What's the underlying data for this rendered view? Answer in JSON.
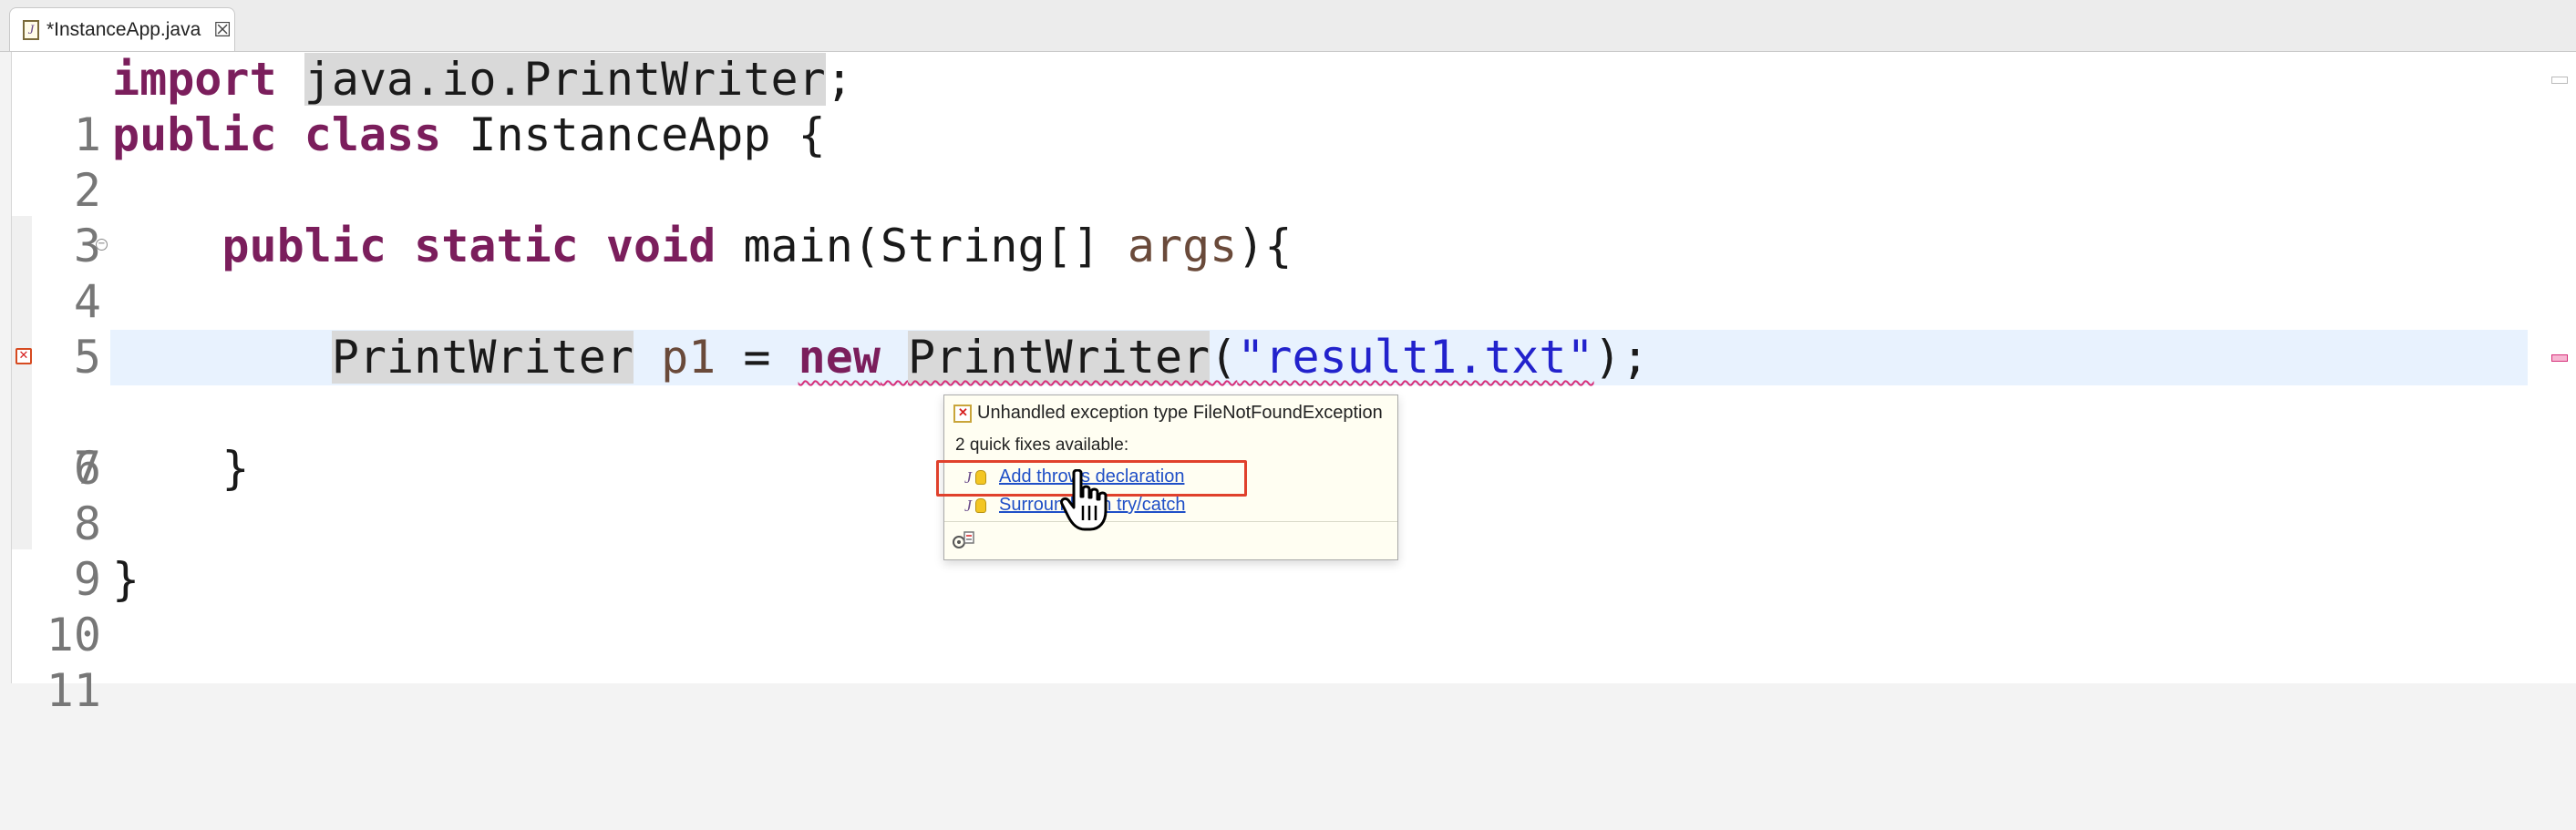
{
  "tab": {
    "label": "*InstanceApp.java",
    "close": "☒",
    "icon": "J"
  },
  "editor": {
    "lines": [
      {
        "num": "1",
        "tokens": [
          {
            "t": "import",
            "c": "kw"
          },
          {
            "t": " ",
            "c": ""
          },
          {
            "t": "java.io.PrintWriter",
            "c": "occ"
          },
          {
            "t": ";",
            "c": ""
          }
        ]
      },
      {
        "num": "2",
        "tokens": [
          {
            "t": "public",
            "c": "kw"
          },
          {
            "t": " ",
            "c": ""
          },
          {
            "t": "class",
            "c": "kw"
          },
          {
            "t": " InstanceApp {",
            "c": ""
          }
        ]
      },
      {
        "num": "3",
        "tokens": []
      },
      {
        "num": "4",
        "tokens": [
          {
            "t": "    ",
            "c": ""
          },
          {
            "t": "public",
            "c": "kw"
          },
          {
            "t": " ",
            "c": ""
          },
          {
            "t": "static",
            "c": "kw"
          },
          {
            "t": " ",
            "c": ""
          },
          {
            "t": "void",
            "c": "kw"
          },
          {
            "t": " main(String[] ",
            "c": ""
          },
          {
            "t": "args",
            "c": "var"
          },
          {
            "t": "){",
            "c": ""
          }
        ]
      },
      {
        "num": "5",
        "tokens": []
      },
      {
        "num": "6",
        "tokens": [
          {
            "t": "        ",
            "c": ""
          },
          {
            "t": "PrintWriter",
            "c": "occ"
          },
          {
            "t": " ",
            "c": ""
          },
          {
            "t": "p1",
            "c": "var"
          },
          {
            "t": " = ",
            "c": ""
          },
          {
            "t": "new",
            "c": "kw err"
          },
          {
            "t": " ",
            "c": "err"
          },
          {
            "t": "PrintWriter",
            "c": "occ err"
          },
          {
            "t": "(",
            "c": "err"
          },
          {
            "t": "\"result1.txt\"",
            "c": "str err"
          },
          {
            "t": ");",
            "c": ""
          }
        ]
      },
      {
        "num": "7",
        "tokens": []
      },
      {
        "num": "8",
        "tokens": [
          {
            "t": "    }",
            "c": ""
          }
        ]
      },
      {
        "num": "9",
        "tokens": []
      },
      {
        "num": "10",
        "tokens": [
          {
            "t": "}",
            "c": ""
          }
        ]
      },
      {
        "num": "11",
        "tokens": []
      }
    ]
  },
  "quickfix": {
    "title": "Unhandled exception type FileNotFoundException",
    "subtitle": "2 quick fixes available:",
    "fixes": [
      {
        "label": "Add throws declaration"
      },
      {
        "label": "Surround with try/catch"
      }
    ]
  },
  "colors": {
    "keyword": "#7b1e5c",
    "string": "#2222cc",
    "error_underline": "#d6307a",
    "highlight_box": "#e0412c",
    "current_line": "#e8f2fe"
  }
}
